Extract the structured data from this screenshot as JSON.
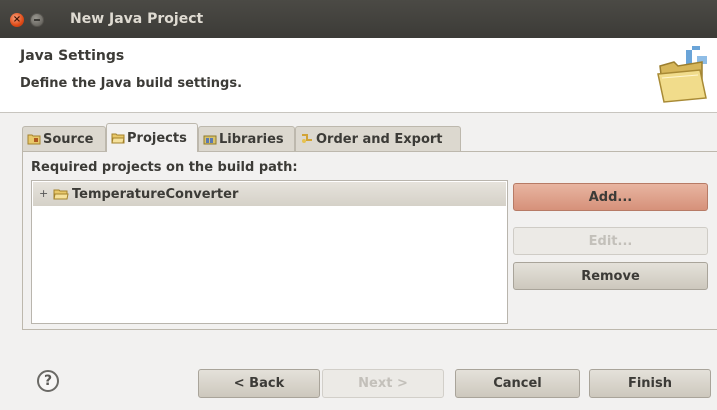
{
  "window": {
    "title": "New Java Project",
    "close_glyph": "×"
  },
  "header": {
    "title": "Java Settings",
    "description": "Define the Java build settings.",
    "icon": "folder-wizard-icon"
  },
  "tabs": [
    {
      "label": "Source",
      "icon": "source-folder-icon",
      "active": false
    },
    {
      "label": "Projects",
      "icon": "project-folder-icon",
      "active": true
    },
    {
      "label": "Libraries",
      "icon": "libraries-icon",
      "active": false
    },
    {
      "label": "Order and Export",
      "icon": "order-export-icon",
      "active": false
    }
  ],
  "projects_tab": {
    "list_label": "Required projects on the build path:",
    "items": [
      {
        "expander": "+",
        "label": "TemperatureConverter",
        "icon": "project-folder-icon"
      }
    ],
    "buttons": {
      "add": "Add...",
      "edit": "Edit...",
      "remove": "Remove"
    }
  },
  "footer": {
    "help_glyph": "?",
    "back": "< Back",
    "next": "Next >",
    "cancel": "Cancel",
    "finish": "Finish"
  },
  "colors": {
    "titlebar": "#3c3b37",
    "window_bg": "#f2f1f0",
    "close_button": "#df4a16",
    "add_button_hot": "#d6917a"
  }
}
